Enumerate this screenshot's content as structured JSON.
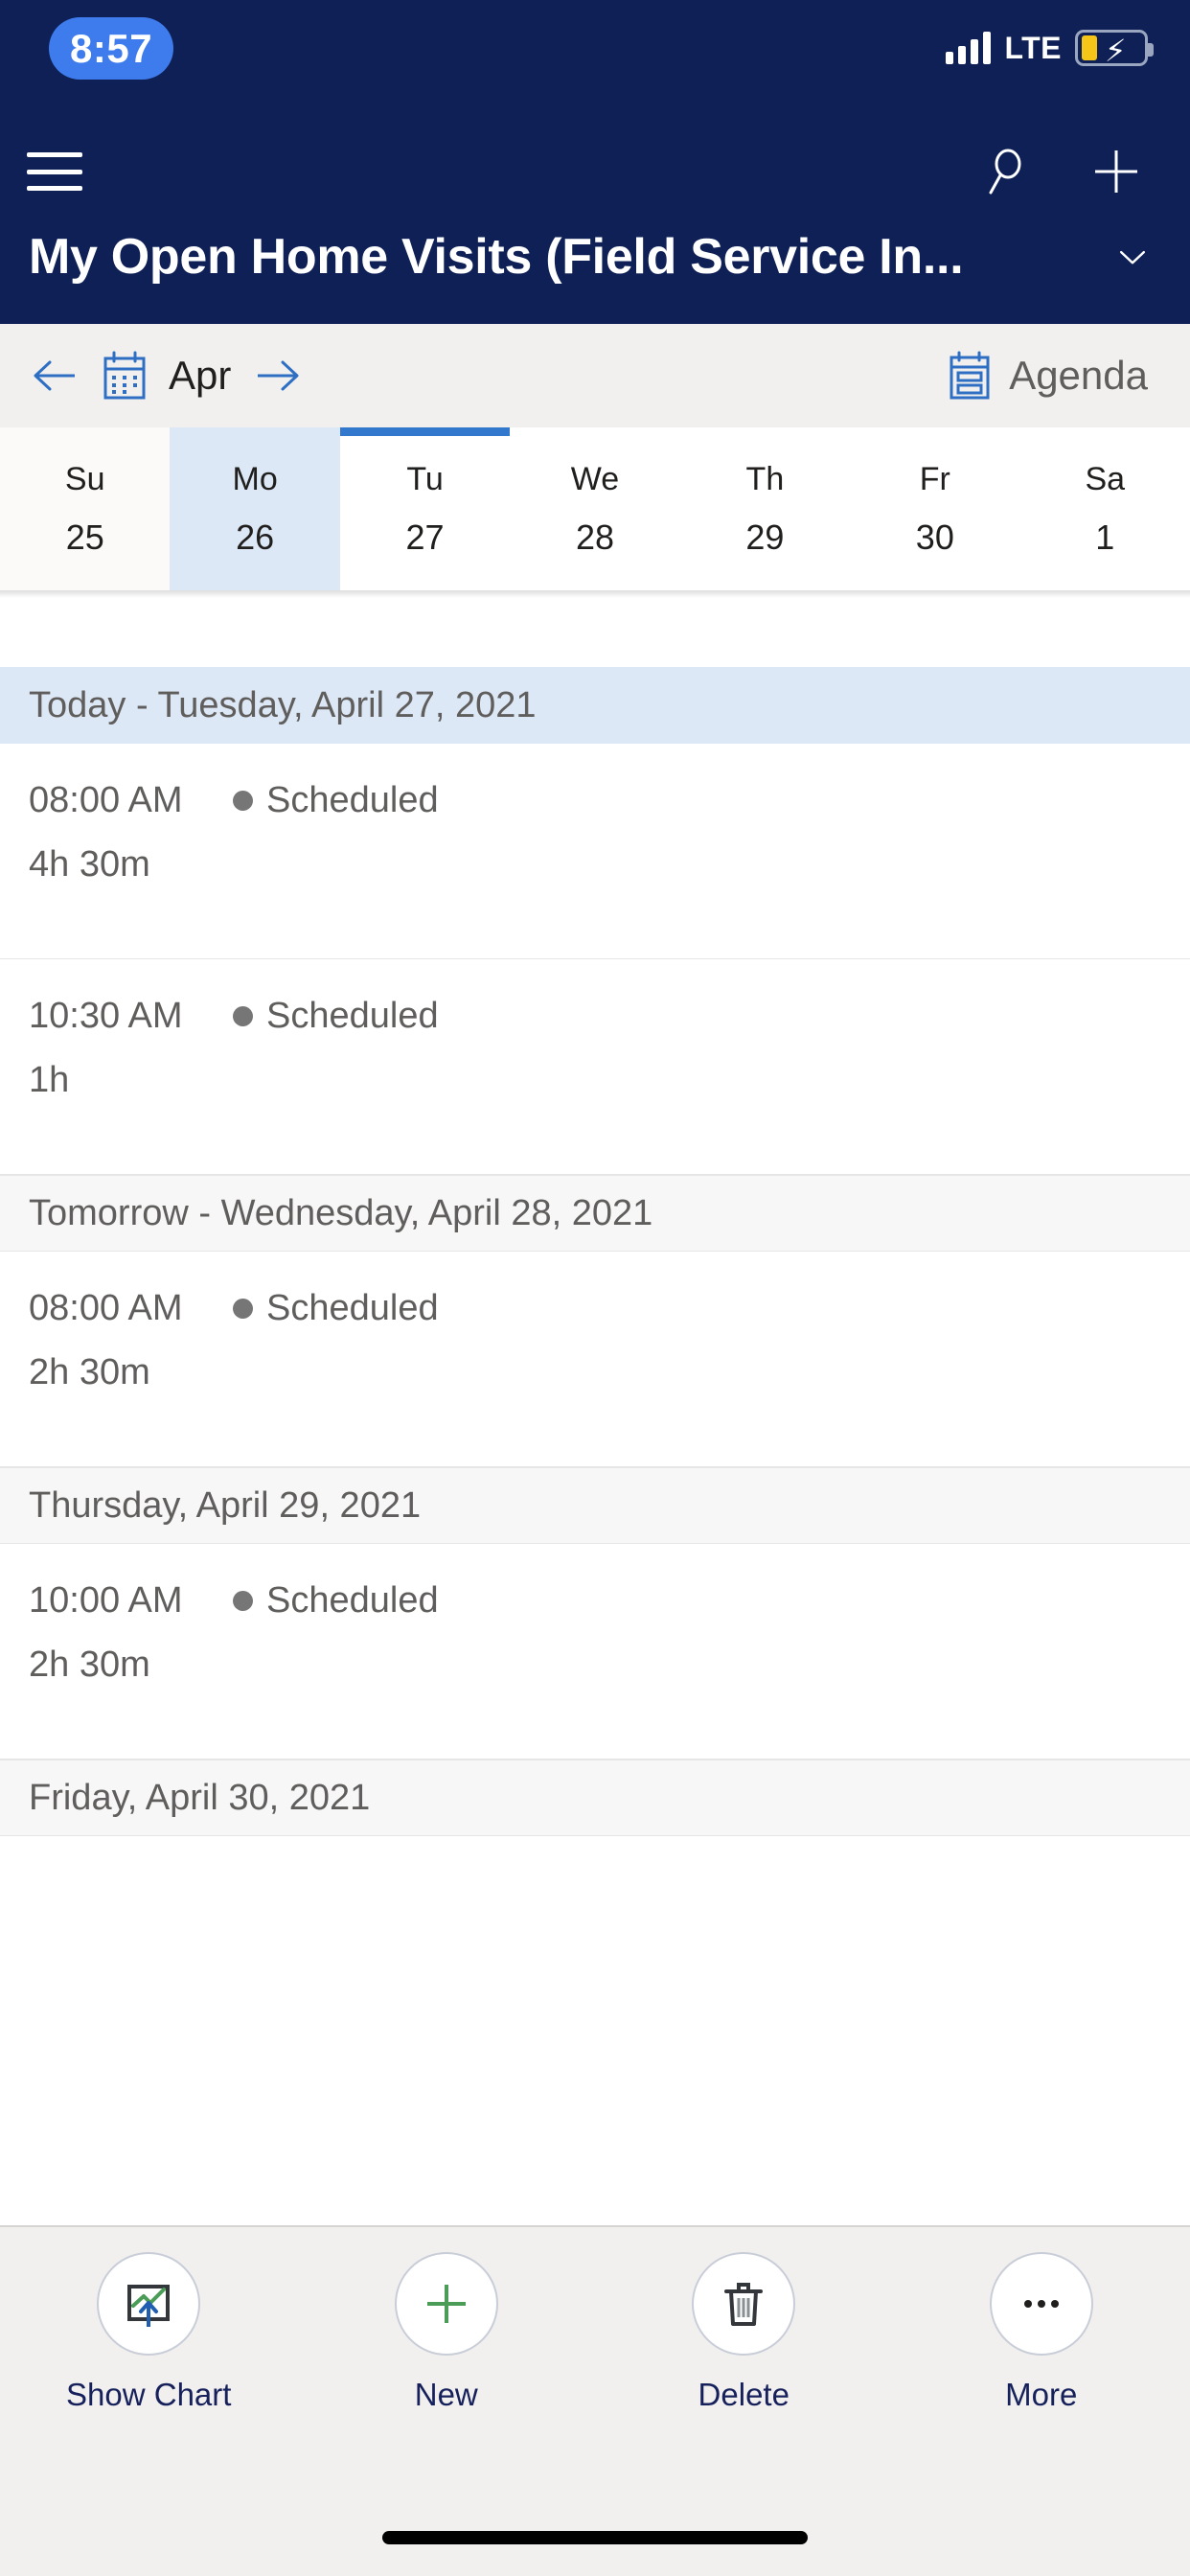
{
  "status_bar": {
    "time": "8:57",
    "network": "LTE",
    "signal_icon": "signal-bars-icon",
    "battery_icon": "battery-charging-icon"
  },
  "app_header": {
    "menu_icon": "hamburger-menu-icon",
    "search_icon": "search-icon",
    "new_icon": "plus-icon",
    "title": "My Open Home Visits (Field Service In...",
    "chevron": "⌄",
    "chevron_icon": "chevron-down-icon"
  },
  "calendar_nav": {
    "prev_icon": "arrow-left-icon",
    "next_icon": "arrow-right-icon",
    "prev_arrow": "←",
    "next_arrow": "→",
    "calendar_icon": "calendar-icon",
    "month_label": "Apr",
    "agenda_icon": "agenda-list-icon",
    "agenda_label": "Agenda"
  },
  "week_strip": {
    "days": [
      {
        "dow": "Su",
        "num": "25",
        "selected": false,
        "today": false,
        "weekend": true
      },
      {
        "dow": "Mo",
        "num": "26",
        "selected": true,
        "today": false,
        "weekend": false
      },
      {
        "dow": "Tu",
        "num": "27",
        "selected": false,
        "today": true,
        "weekend": false
      },
      {
        "dow": "We",
        "num": "28",
        "selected": false,
        "today": false,
        "weekend": false
      },
      {
        "dow": "Th",
        "num": "29",
        "selected": false,
        "today": false,
        "weekend": false
      },
      {
        "dow": "Fr",
        "num": "30",
        "selected": false,
        "today": false,
        "weekend": false
      },
      {
        "dow": "Sa",
        "num": "1",
        "selected": false,
        "today": false,
        "weekend": false
      }
    ]
  },
  "agenda": {
    "groups": [
      {
        "header": "Today - Tuesday, April 27, 2021",
        "is_today": true,
        "events": [
          {
            "time": "08:00 AM",
            "status": "Scheduled",
            "duration": "4h 30m"
          },
          {
            "time": "10:30 AM",
            "status": "Scheduled",
            "duration": "1h"
          }
        ]
      },
      {
        "header": "Tomorrow - Wednesday, April 28, 2021",
        "is_today": false,
        "events": [
          {
            "time": "08:00 AM",
            "status": "Scheduled",
            "duration": "2h 30m"
          }
        ]
      },
      {
        "header": "Thursday, April 29, 2021",
        "is_today": false,
        "events": [
          {
            "time": "10:00 AM",
            "status": "Scheduled",
            "duration": "2h 30m"
          }
        ]
      },
      {
        "header": "Friday, April 30, 2021",
        "is_today": false,
        "events": []
      }
    ]
  },
  "command_bar": {
    "buttons": [
      {
        "label": "Show Chart",
        "icon": "show-chart-icon"
      },
      {
        "label": "New",
        "icon": "plus-icon"
      },
      {
        "label": "Delete",
        "icon": "trash-icon"
      },
      {
        "label": "More",
        "icon": "ellipsis-icon"
      }
    ]
  },
  "colors": {
    "header_navy": "#0e2055",
    "accent_blue": "#3278cc",
    "today_band": "#dde8f6",
    "toolbar_bg": "#f1f0ee",
    "status_dot": "#767676",
    "label_navy": "#16215b",
    "green": "#4a9c56"
  }
}
